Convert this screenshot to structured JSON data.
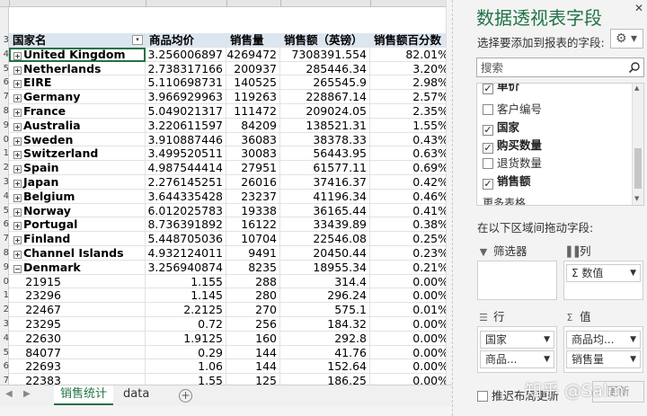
{
  "pivot_table": {
    "headers": [
      "国家名",
      "商品均价",
      "销售量",
      "销售额（英镑）",
      "销售额百分数"
    ],
    "country_rows": [
      {
        "name": "United Kingdom",
        "avg_price": "3.256006897",
        "qty": "4269472",
        "sales": "7308391.554",
        "pct": "82.01%"
      },
      {
        "name": "Netherlands",
        "avg_price": "2.738317166",
        "qty": "200937",
        "sales": "285446.34",
        "pct": "3.20%"
      },
      {
        "name": "EIRE",
        "avg_price": "5.110698731",
        "qty": "140525",
        "sales": "265545.9",
        "pct": "2.98%"
      },
      {
        "name": "Germany",
        "avg_price": "3.966929963",
        "qty": "119263",
        "sales": "228867.14",
        "pct": "2.57%"
      },
      {
        "name": "France",
        "avg_price": "5.049021317",
        "qty": "111472",
        "sales": "209024.05",
        "pct": "2.35%"
      },
      {
        "name": "Australia",
        "avg_price": "3.220611597",
        "qty": "84209",
        "sales": "138521.31",
        "pct": "1.55%"
      },
      {
        "name": "Sweden",
        "avg_price": "3.910887446",
        "qty": "36083",
        "sales": "38378.33",
        "pct": "0.43%"
      },
      {
        "name": "Switzerland",
        "avg_price": "3.499520511",
        "qty": "30083",
        "sales": "56443.95",
        "pct": "0.63%"
      },
      {
        "name": "Spain",
        "avg_price": "4.987544414",
        "qty": "27951",
        "sales": "61577.11",
        "pct": "0.69%"
      },
      {
        "name": "Japan",
        "avg_price": "2.276145251",
        "qty": "26016",
        "sales": "37416.37",
        "pct": "0.42%"
      },
      {
        "name": "Belgium",
        "avg_price": "3.644335428",
        "qty": "23237",
        "sales": "41196.34",
        "pct": "0.46%"
      },
      {
        "name": "Norway",
        "avg_price": "6.012025783",
        "qty": "19338",
        "sales": "36165.44",
        "pct": "0.41%"
      },
      {
        "name": "Portugal",
        "avg_price": "8.736391892",
        "qty": "16122",
        "sales": "33439.89",
        "pct": "0.38%"
      },
      {
        "name": "Finland",
        "avg_price": "5.448705036",
        "qty": "10704",
        "sales": "22546.08",
        "pct": "0.25%"
      },
      {
        "name": "Channel Islands",
        "avg_price": "4.932124011",
        "qty": "9491",
        "sales": "20450.44",
        "pct": "0.23%"
      },
      {
        "name": "Denmark",
        "avg_price": "3.256940874",
        "qty": "8235",
        "sales": "18955.34",
        "pct": "0.21%"
      }
    ],
    "sub_rows": [
      {
        "id": "21915",
        "avg_price": "1.155",
        "qty": "288",
        "sales": "314.4",
        "pct": "0.00%"
      },
      {
        "id": "23296",
        "avg_price": "1.145",
        "qty": "280",
        "sales": "296.24",
        "pct": "0.00%"
      },
      {
        "id": "22467",
        "avg_price": "2.2125",
        "qty": "270",
        "sales": "575.1",
        "pct": "0.01%"
      },
      {
        "id": "23295",
        "avg_price": "0.72",
        "qty": "256",
        "sales": "184.32",
        "pct": "0.00%"
      },
      {
        "id": "22630",
        "avg_price": "1.9125",
        "qty": "160",
        "sales": "292.8",
        "pct": "0.00%"
      },
      {
        "id": "84077",
        "avg_price": "0.29",
        "qty": "144",
        "sales": "41.76",
        "pct": "0.00%"
      },
      {
        "id": "22693",
        "avg_price": "1.06",
        "qty": "144",
        "sales": "152.64",
        "pct": "0.00%"
      },
      {
        "id": "22383",
        "avg_price": "1.55",
        "qty": "125",
        "sales": "186.25",
        "pct": "0.00%"
      }
    ],
    "row_numbers": [
      "3",
      "4",
      "5",
      "6",
      "7",
      "8",
      "9",
      "0",
      "1",
      "2",
      "3",
      "4",
      "5",
      "6",
      "7",
      "8",
      "9",
      "0",
      "1",
      "2",
      "3",
      "4",
      "5",
      "6",
      "7"
    ]
  },
  "sheet_tabs": {
    "prev": "◀",
    "next": "▶",
    "active": "销售统计",
    "other": "data",
    "add": "+"
  },
  "field_panel": {
    "title": "数据透视表字段",
    "close": "✕",
    "subtitle": "选择要添加到报表的字段:",
    "gear": "⚙ ▾",
    "search_placeholder": "搜索",
    "fields": [
      {
        "label": "单价",
        "checked": true
      },
      {
        "label": "客户编号",
        "checked": false
      },
      {
        "label": "国家",
        "checked": true
      },
      {
        "label": "购买数量",
        "checked": true
      },
      {
        "label": "退货数量",
        "checked": false
      },
      {
        "label": "销售额",
        "checked": true
      }
    ],
    "more_tables": "更多表格...",
    "drag_hint": "在以下区域间拖动字段:",
    "areas": {
      "filter": {
        "title": "筛选器",
        "icon": "filter-icon"
      },
      "columns": {
        "title": "列",
        "icon": "columns-icon",
        "chips": [
          "Σ 数值"
        ]
      },
      "rows": {
        "title": "行",
        "icon": "rows-icon",
        "chips": [
          "国家",
          "商品..."
        ]
      },
      "values": {
        "title": "值",
        "icon": "sigma-icon",
        "chips": [
          "商品均...",
          "销售量"
        ]
      }
    },
    "defer_label": "推迟布局更新",
    "update_button": "更新"
  },
  "watermark": "知乎 @Salm",
  "colors": {
    "accent": "#217346",
    "header_bg": "#dce6f1",
    "panel_bg": "#f3f3f3"
  }
}
